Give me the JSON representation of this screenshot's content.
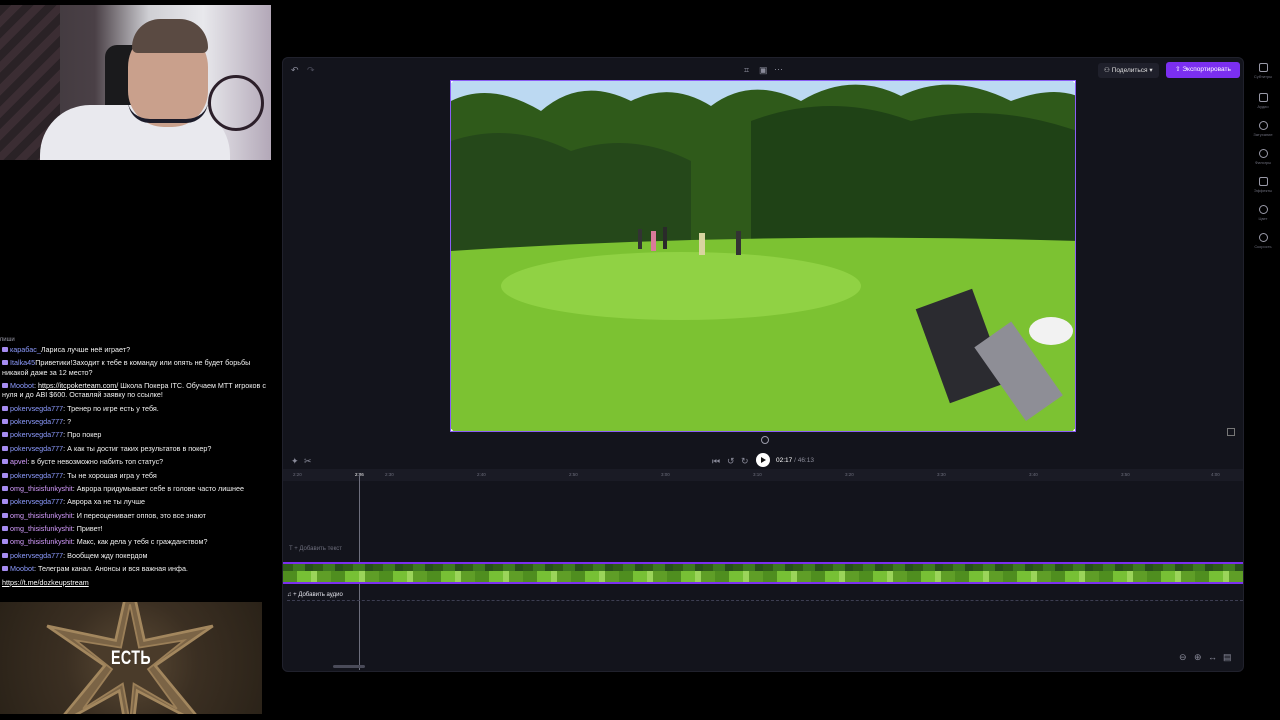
{
  "chat": {
    "cut_line": "пиши",
    "messages": [
      {
        "user": "карабас_",
        "text": "Лариса лучше неё играет?"
      },
      {
        "user": "Italka45",
        "text": "Приветики!Заходит к тебе в команду или опять не будет борьбы никакой даже за 12 место?"
      },
      {
        "user": "Moobot",
        "text": ": ",
        "link": "https://itcpokerteam.com/",
        "text2": " Школа Покера ITC. Обучаем МТТ игроков с нуля и до ABI $600. Оставляй заявку по ссылке!"
      },
      {
        "user": "pokervsegda777",
        "text": ": Тренер по игре есть у тебя."
      },
      {
        "user": "pokervsegda777",
        "text": ": ?"
      },
      {
        "user": "pokervsegda777",
        "text": ": Про покер"
      },
      {
        "user": "pokervsegda777",
        "text": ": А как ты достиг таких результатов в покер?"
      },
      {
        "user": "apvel",
        "text": ": в бусте невозможно набить топ статус?"
      },
      {
        "user": "pokervsegda777",
        "text": ": Ты не хорошая игра у тебя"
      },
      {
        "user": "omg_thisisfunkyshit",
        "text": ": Аврора придумывает себе в голове часто лишнее"
      },
      {
        "user": "pokervsegda777",
        "text": ": Аврора ха не ты лучше"
      },
      {
        "user": "omg_thisisfunkyshit",
        "text": ": И переоценивает оппов, это все знают"
      },
      {
        "user": "omg_thisisfunkyshit",
        "text": ": Привет!"
      },
      {
        "user": "omg_thisisfunkyshit",
        "text": ": Макс, как дела у тебя с гражданством?"
      },
      {
        "user": "pokervsegda777",
        "text": ": Вообщем жду покердом"
      },
      {
        "user": "Moobot",
        "text": ": Телеграм канал. Анонсы и вся важная инфа."
      }
    ],
    "trailing_link": "https://t.me/dozkeupstream"
  },
  "overlay": {
    "word": "ЕСТЬ"
  },
  "editor": {
    "share_label": "Поделиться",
    "export_label": "Экспортировать",
    "current_time": "02:17",
    "duration": "/ 46:13",
    "ruler_ticks": [
      "2:20",
      "2:26",
      "2:30",
      "2:40",
      "2:50",
      "3:00",
      "3:10",
      "3:20",
      "3:30",
      "3:40",
      "3:50",
      "4:00"
    ],
    "add_text_label": "+ Добавить текст",
    "add_audio_label": "+ Добавить аудио"
  },
  "rail": {
    "items": [
      {
        "icon": "captions-icon",
        "label": "Субтитры"
      },
      {
        "icon": "audio-icon",
        "label": "Аудио"
      },
      {
        "icon": "fade-icon",
        "label": "Затухание"
      },
      {
        "icon": "filters-icon",
        "label": "Фильтры"
      },
      {
        "icon": "effects-icon",
        "label": "Эффекты"
      },
      {
        "icon": "color-icon",
        "label": "Цвет"
      },
      {
        "icon": "speed-icon",
        "label": "Скорость"
      }
    ]
  },
  "colors": {
    "accent": "#7b2ff0",
    "selection": "#8a5cf6",
    "panel": "#13141c"
  }
}
